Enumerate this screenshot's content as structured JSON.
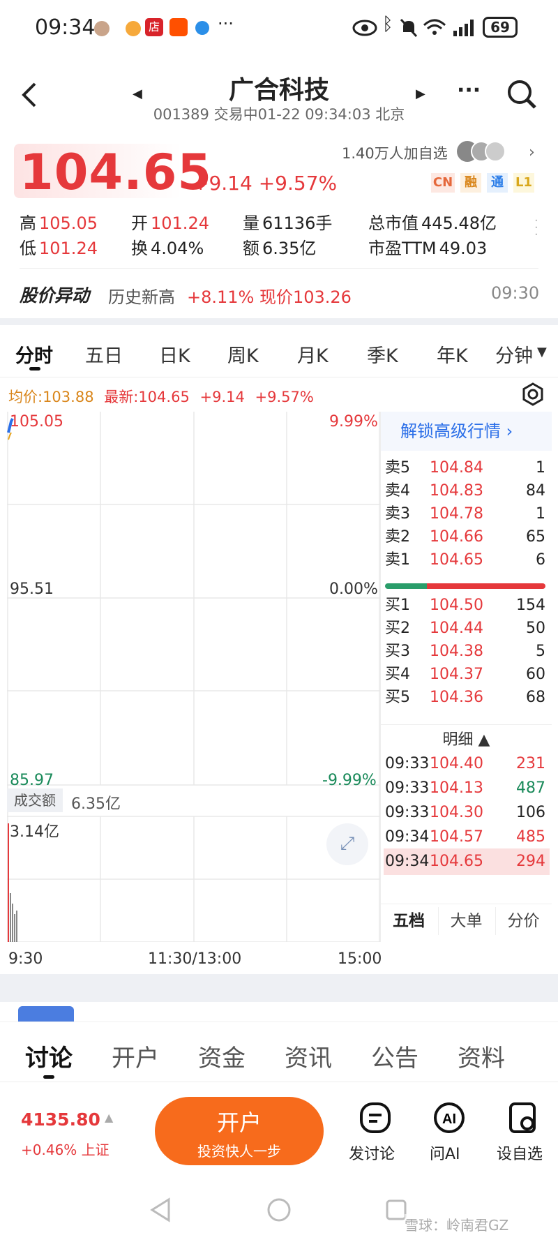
{
  "status": {
    "time": "09:34",
    "battery": "69"
  },
  "header": {
    "title": "广合科技",
    "code": "001389",
    "sub": "交易中01-22 09:34:03 北京",
    "watchers": "1.40万人加自选"
  },
  "quote": {
    "price": "104.65",
    "change": "+9.14",
    "pct": "+9.57%",
    "badges": [
      "CN",
      "融",
      "通",
      "L1"
    ]
  },
  "stats": [
    {
      "label": "高",
      "value": "105.05",
      "color": "red"
    },
    {
      "label": "开",
      "value": "101.24",
      "color": "red"
    },
    {
      "label": "量",
      "value": "61136手",
      "color": "dark"
    },
    {
      "label": "总市值",
      "value": "445.48亿",
      "color": "dark"
    },
    {
      "label": "低",
      "value": "101.24",
      "color": "red"
    },
    {
      "label": "换",
      "value": "4.04%",
      "color": "dark"
    },
    {
      "label": "额",
      "value": "6.35亿",
      "color": "dark"
    },
    {
      "label": "市盈TTM",
      "value": "49.03",
      "color": "dark"
    }
  ],
  "alert": {
    "title": "股价异动",
    "text1": "历史新高",
    "text2": "+8.11% 现价103.26",
    "time": "09:30"
  },
  "tabs": [
    "分时",
    "五日",
    "日K",
    "周K",
    "月K",
    "季K",
    "年K",
    "分钟"
  ],
  "chart_info": {
    "avg": "均价:103.88",
    "latest": "最新:104.65",
    "change": "+9.14",
    "pct": "+9.57%"
  },
  "chart": {
    "y_top": "105.05",
    "y_mid": "95.51",
    "y_bot": "85.97",
    "pct_top": "9.99%",
    "pct_mid": "0.00%",
    "pct_bot": "-9.99%",
    "vol_label": "成交额",
    "vol_total": "6.35亿",
    "vol_max": "3.14亿",
    "x_labels": [
      "9:30",
      "11:30/13:00",
      "15:00"
    ]
  },
  "orderbook": {
    "unlock": "解锁高级行情",
    "asks": [
      {
        "label": "卖5",
        "price": "104.84",
        "qty": "1"
      },
      {
        "label": "卖4",
        "price": "104.83",
        "qty": "84"
      },
      {
        "label": "卖3",
        "price": "104.78",
        "qty": "1"
      },
      {
        "label": "卖2",
        "price": "104.66",
        "qty": "65"
      },
      {
        "label": "卖1",
        "price": "104.65",
        "qty": "6"
      }
    ],
    "bids": [
      {
        "label": "买1",
        "price": "104.50",
        "qty": "154"
      },
      {
        "label": "买2",
        "price": "104.44",
        "qty": "50"
      },
      {
        "label": "买3",
        "price": "104.38",
        "qty": "5"
      },
      {
        "label": "买4",
        "price": "104.37",
        "qty": "60"
      },
      {
        "label": "买5",
        "price": "104.36",
        "qty": "68"
      }
    ],
    "detail_title": "明细",
    "trades": [
      {
        "time": "09:33",
        "price": "104.40",
        "qty": "231",
        "dir": "up"
      },
      {
        "time": "09:33",
        "price": "104.13",
        "qty": "487",
        "dir": "down"
      },
      {
        "time": "09:33",
        "price": "104.30",
        "qty": "106",
        "dir": "neutral"
      },
      {
        "time": "09:34",
        "price": "104.57",
        "qty": "485",
        "dir": "up"
      },
      {
        "time": "09:34",
        "price": "104.65",
        "qty": "294",
        "dir": "up"
      }
    ],
    "subtabs": [
      "五档",
      "大单",
      "分价"
    ]
  },
  "bottom_tabs": [
    "讨论",
    "开户",
    "资金",
    "资讯",
    "公告",
    "资料"
  ],
  "footer": {
    "index_value": "4135.80",
    "index_change": "+0.46%",
    "index_name": "上证",
    "cta_title": "开户",
    "cta_sub": "投资快人一步",
    "actions": [
      "发讨论",
      "问AI",
      "设自选"
    ]
  },
  "watermark": "雪球：岭南君GZ"
}
